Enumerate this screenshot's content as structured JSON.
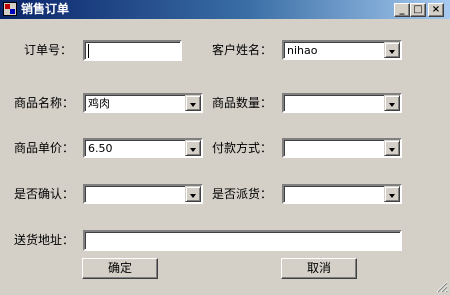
{
  "window": {
    "title": "销售订单",
    "caption_buttons": {
      "minimize": "_",
      "maximize": "□",
      "close": "×"
    }
  },
  "form": {
    "order_no": {
      "label": "订单号：",
      "value": ""
    },
    "customer_name": {
      "label": "客户姓名：",
      "value": "nihao"
    },
    "product_name": {
      "label": "商品名称：",
      "value": "鸡肉"
    },
    "product_qty": {
      "label": "商品数量：",
      "value": ""
    },
    "unit_price": {
      "label": "商品单价：",
      "value": "6.50"
    },
    "payment_method": {
      "label": "付款方式：",
      "value": ""
    },
    "confirmed": {
      "label": "是否确认：",
      "value": ""
    },
    "dispatched": {
      "label": "是否派货：",
      "value": ""
    },
    "address": {
      "label": "送货地址：",
      "value": ""
    }
  },
  "buttons": {
    "ok": "确定",
    "cancel": "取消"
  }
}
